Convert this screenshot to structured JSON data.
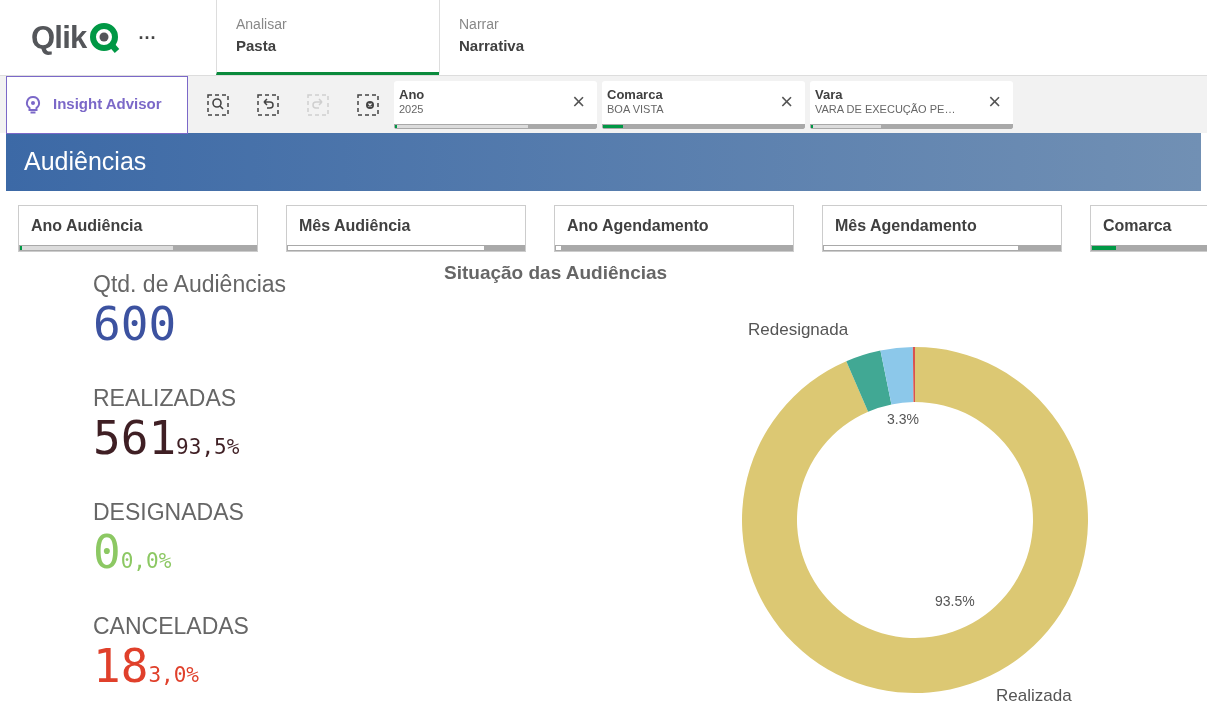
{
  "header": {
    "logo_text": "Qlik",
    "more": "···",
    "tabs": [
      {
        "caption": "Analisar",
        "label": "Pasta",
        "selected": true
      },
      {
        "caption": "Narrar",
        "label": "Narrativa",
        "selected": false
      }
    ]
  },
  "toolbar": {
    "insight_advisor": "Insight Advisor",
    "tools": [
      {
        "kind": "search",
        "disabled": false
      },
      {
        "kind": "back",
        "disabled": false
      },
      {
        "kind": "forward",
        "disabled": true
      },
      {
        "kind": "clear",
        "disabled": false
      }
    ],
    "selections": [
      {
        "field": "Ano",
        "value": "2025",
        "close": "×",
        "bar": {
          "kind": "alternative",
          "level": 0.66,
          "selection": {
            "level": 0.01
          }
        }
      },
      {
        "field": "Comarca",
        "value": "BOA VISTA",
        "close": "×",
        "bar": {
          "kind": "selected",
          "level": 0.1
        }
      },
      {
        "field": "Vara",
        "value": "VARA DE EXECUÇÃO PE…",
        "close": "×",
        "bar": {
          "kind": "alternative",
          "level": 0.35,
          "selection": {
            "level": 0.01
          }
        }
      }
    ]
  },
  "sheet_title": "Audiências",
  "filter_panes": [
    {
      "label": "Ano Audiência",
      "bar": {
        "kind": "alternative",
        "level": 0.65,
        "selection": {
          "level": 0.01
        }
      }
    },
    {
      "label": "Mês Audiência",
      "bar": {
        "kind": "possible",
        "level": 0.83
      }
    },
    {
      "label": "Ano Agendamento",
      "bar": {
        "kind": "possible",
        "level": 0.02
      }
    },
    {
      "label": "Mês Agendamento",
      "bar": {
        "kind": "possible",
        "level": 0.82
      }
    },
    {
      "label": "Comarca",
      "bar": {
        "kind": "selected",
        "level": 0.1
      }
    }
  ],
  "kpis": [
    {
      "label": "Qtd. de Audiências",
      "value": "600",
      "color": "#3c52a0"
    },
    {
      "label": "REALIZADAS",
      "value": "561",
      "percent": "93,5%",
      "color": "#3f1f24"
    },
    {
      "label": "DESIGNADAS",
      "value": "0",
      "percent": "0,0%",
      "color": "#8cc863"
    },
    {
      "label": "CANCELADAS",
      "value": "18",
      "percent": "3,0%",
      "color": "#e0402b"
    }
  ],
  "chart": {
    "chart_data": {
      "type": "donut",
      "title": "Situação das Audiências",
      "categories": [
        "Realizada",
        "Redesignada",
        null,
        null
      ],
      "series": [
        {
          "values": [
            93.5,
            3.3,
            3.0,
            0.2
          ],
          "colors": [
            "#dcc873",
            "#41a894",
            "#8cc8ea",
            "#d9534f"
          ]
        }
      ],
      "value_labels": [
        "93.5%",
        "3.3%",
        null,
        null
      ]
    }
  }
}
